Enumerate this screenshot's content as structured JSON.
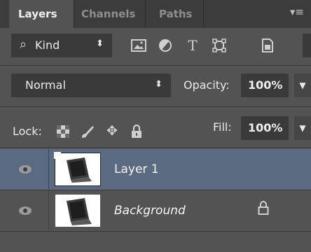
{
  "tabs": [
    "Layers",
    "Channels",
    "Paths"
  ],
  "panel_menu_icon": "panel-menu-icon",
  "filter": {
    "kind_label": "Kind",
    "icons": [
      "pixel-filter-icon",
      "adjustment-filter-icon",
      "type-filter-icon",
      "shape-filter-icon",
      "smart-object-filter-icon"
    ]
  },
  "blend": {
    "mode": "Normal"
  },
  "opacity": {
    "label": "Opacity:",
    "value": "100%"
  },
  "lock": {
    "label": "Lock:",
    "icons": [
      "lock-transparent-pixels-icon",
      "lock-image-pixels-icon",
      "lock-position-icon",
      "lock-all-icon"
    ]
  },
  "fill": {
    "label": "Fill:",
    "value": "100%"
  },
  "layers": [
    {
      "name": "Layer 1",
      "selected": true,
      "locked": false
    },
    {
      "name": "Background",
      "selected": false,
      "locked": true
    }
  ],
  "colors": {
    "panel_bg": "#535353",
    "selected_row": "#5b6a80",
    "field_bg": "#3a3a3a",
    "tabbar_bg": "#3c3c3c"
  }
}
